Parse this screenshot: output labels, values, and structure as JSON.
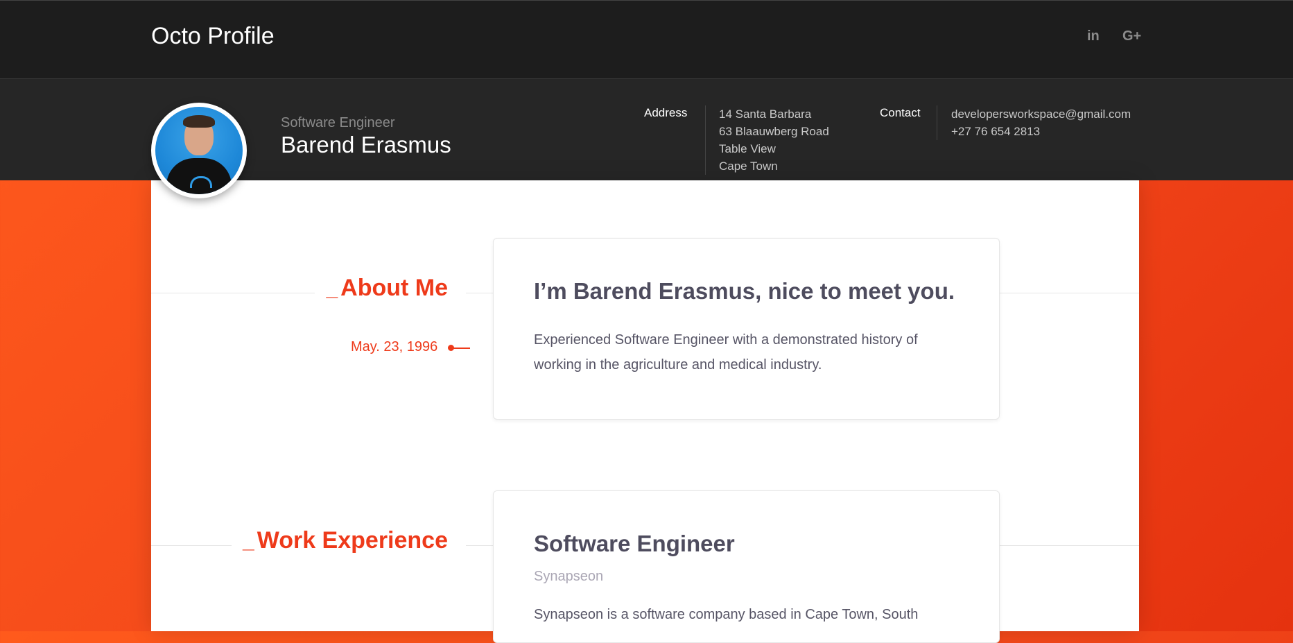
{
  "header": {
    "brand": "Octo Profile",
    "social": {
      "linkedin_label": "in",
      "googleplus_label": "G+"
    }
  },
  "profile": {
    "job_title": "Software Engineer",
    "name": "Barend Erasmus",
    "address_label": "Address",
    "address_lines": [
      "14 Santa Barbara",
      "63 Blaauwberg Road",
      "Table View",
      "Cape Town"
    ],
    "contact_label": "Contact",
    "contact_lines": [
      "developersworkspace@gmail.com",
      "+27 76 654 2813"
    ]
  },
  "about": {
    "section_label": "About Me",
    "date": "May. 23, 1996",
    "heading": "I’m Barend Erasmus, nice to meet you.",
    "text": "Experienced Software Engineer with a demonstrated history of working in the agriculture and medical industry."
  },
  "work": {
    "section_label": "Work Experience",
    "role": "Software Engineer",
    "company": "Synapseon",
    "text": "Synapseon is a software company based in Cape Town, South"
  },
  "colors": {
    "accent": "#ee3a1a",
    "topbar": "#1d1d1d",
    "profilebar": "#262626"
  },
  "icons": [
    "linkedin-icon",
    "googleplus-icon",
    "timeline-dot-icon"
  ]
}
